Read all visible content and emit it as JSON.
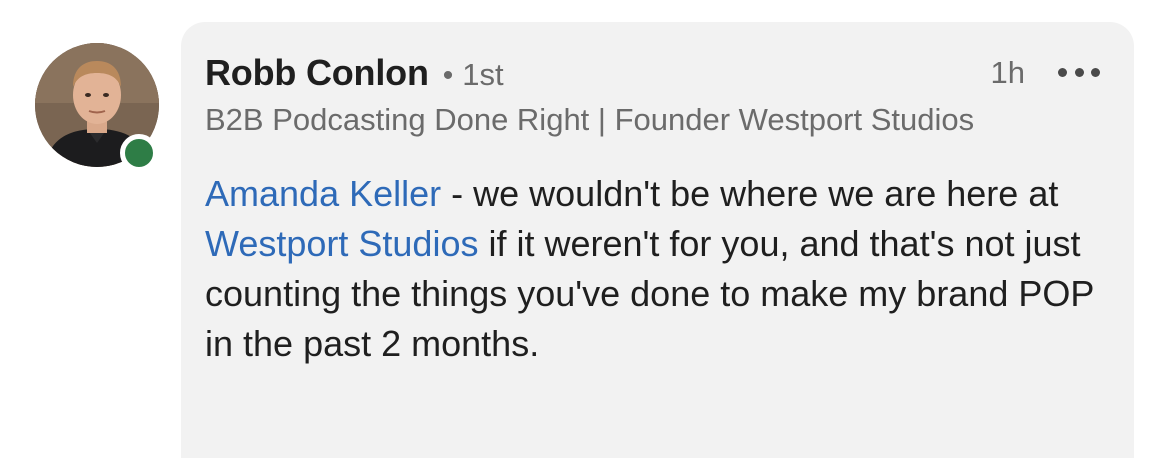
{
  "comment": {
    "author": {
      "name": "Robb Conlon",
      "connection_degree": "1st",
      "headline": "B2B Podcasting Done Right | Founder Westport Studios",
      "online": true,
      "presence_color": "#2e7d46"
    },
    "separator": "•",
    "timestamp": "1h",
    "more_icon": "ellipsis-horizontal-icon",
    "body": {
      "mention_1": "Amanda Keller",
      "text_1": " - we wouldn't be where we are here at ",
      "mention_2": "Westport Studios",
      "text_2": " if it weren't for you, and that's not just counting the things you've done to make my brand POP in the past 2 months."
    }
  },
  "colors": {
    "bubble_bg": "#f2f2f2",
    "link": "#2e6ab8",
    "text": "#1f1f1f",
    "muted": "#6b6b6b"
  }
}
